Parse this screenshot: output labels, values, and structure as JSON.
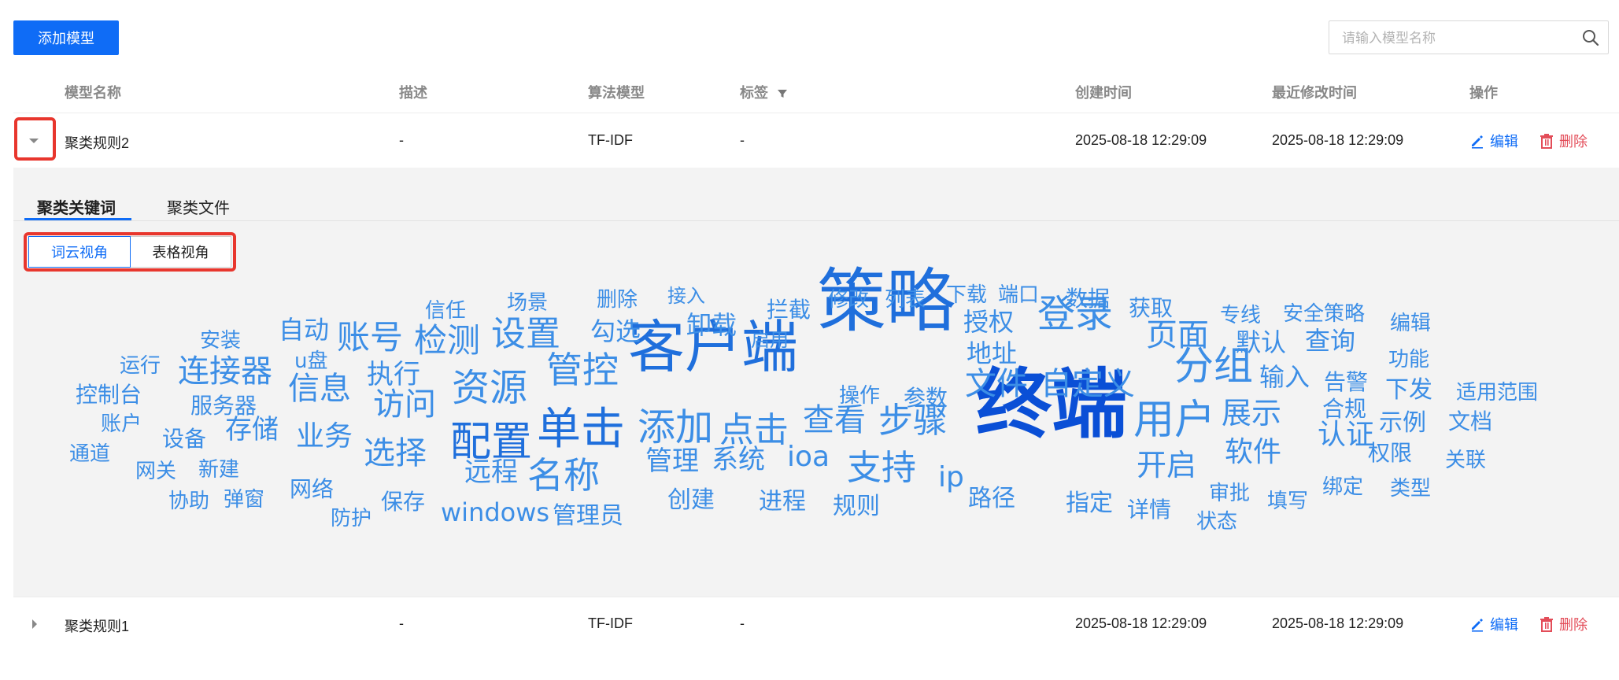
{
  "toolbar": {
    "add_label": "添加模型",
    "search_placeholder": "请输入模型名称"
  },
  "columns": {
    "name": "模型名称",
    "desc": "描述",
    "algo": "算法模型",
    "tags": "标签",
    "created": "创建时间",
    "modified": "最近修改时间",
    "actions": "操作"
  },
  "rows": [
    {
      "name": "聚类规则2",
      "desc": "-",
      "algo": "TF-IDF",
      "tags": "-",
      "created": "2025-08-18 12:29:09",
      "modified": "2025-08-18 12:29:09",
      "edit": "编辑",
      "delete": "删除",
      "expanded": true
    },
    {
      "name": "聚类规则1",
      "desc": "-",
      "algo": "TF-IDF",
      "tags": "-",
      "created": "2025-08-18 12:29:09",
      "modified": "2025-08-18 12:29:09",
      "edit": "编辑",
      "delete": "删除",
      "expanded": false
    }
  ],
  "detail": {
    "tabs": [
      {
        "label": "聚类关键词",
        "active": true
      },
      {
        "label": "聚类文件",
        "active": false
      }
    ],
    "views": [
      {
        "label": "词云视角",
        "active": true
      },
      {
        "label": "表格视角",
        "active": false
      }
    ]
  },
  "wordcloud": {
    "colors": {
      "dark": "#0a4fd6",
      "mid": "#1f6fdc",
      "light": "#3c8ee6"
    },
    "words": [
      {
        "text": "终端",
        "tier": "dark"
      },
      {
        "text": "策略",
        "tier": "mid"
      },
      {
        "text": "客户端",
        "tier": "mid"
      },
      {
        "text": "单击",
        "tier": "mid"
      },
      {
        "text": "配置",
        "tier": "mid"
      },
      {
        "text": "添加",
        "tier": "light"
      },
      {
        "text": "点击",
        "tier": "light"
      },
      {
        "text": "用户",
        "tier": "light"
      },
      {
        "text": "分组",
        "tier": "light"
      },
      {
        "text": "登录",
        "tier": "light"
      },
      {
        "text": "资源",
        "tier": "light"
      },
      {
        "text": "管控",
        "tier": "light"
      },
      {
        "text": "设置",
        "tier": "light"
      },
      {
        "text": "检测",
        "tier": "light"
      },
      {
        "text": "账号",
        "tier": "light"
      },
      {
        "text": "连接器",
        "tier": "light"
      },
      {
        "text": "名称",
        "tier": "light"
      },
      {
        "text": "支持",
        "tier": "light"
      },
      {
        "text": "步骤",
        "tier": "light"
      },
      {
        "text": "查看",
        "tier": "light"
      },
      {
        "text": "访问",
        "tier": "light"
      },
      {
        "text": "文件",
        "tier": "light"
      },
      {
        "text": "自定义",
        "tier": "light"
      },
      {
        "text": "页面",
        "tier": "light"
      },
      {
        "text": "选择",
        "tier": "light"
      },
      {
        "text": "信息",
        "tier": "light"
      },
      {
        "text": "展示",
        "tier": "light"
      },
      {
        "text": "开启",
        "tier": "light"
      },
      {
        "text": "软件",
        "tier": "light"
      },
      {
        "text": "业务",
        "tier": "light"
      },
      {
        "text": "ioa",
        "tier": "light"
      },
      {
        "text": "系统",
        "tier": "light"
      },
      {
        "text": "管理",
        "tier": "light"
      },
      {
        "text": "远程",
        "tier": "light"
      },
      {
        "text": "执行",
        "tier": "light"
      },
      {
        "text": "存储",
        "tier": "light"
      },
      {
        "text": "授权",
        "tier": "light"
      },
      {
        "text": "地址",
        "tier": "light"
      },
      {
        "text": "认证",
        "tier": "light"
      },
      {
        "text": "默认",
        "tier": "light"
      },
      {
        "text": "输入",
        "tier": "light"
      },
      {
        "text": "查询",
        "tier": "light"
      },
      {
        "text": "勾选",
        "tier": "light"
      },
      {
        "text": "卸载",
        "tier": "light"
      },
      {
        "text": "自动",
        "tier": "light"
      },
      {
        "text": "ip",
        "tier": "light"
      },
      {
        "text": "windows",
        "tier": "light"
      },
      {
        "text": "管理员",
        "tier": "light"
      },
      {
        "text": "创建",
        "tier": "light"
      },
      {
        "text": "进程",
        "tier": "light"
      },
      {
        "text": "规则",
        "tier": "light"
      },
      {
        "text": "路径",
        "tier": "light"
      },
      {
        "text": "指定",
        "tier": "light"
      },
      {
        "text": "详情",
        "tier": "light"
      },
      {
        "text": "状态",
        "tier": "light"
      },
      {
        "text": "审批",
        "tier": "light"
      },
      {
        "text": "填写",
        "tier": "light"
      },
      {
        "text": "绑定",
        "tier": "light"
      },
      {
        "text": "类型",
        "tier": "light"
      },
      {
        "text": "权限",
        "tier": "light"
      },
      {
        "text": "关联",
        "tier": "light"
      },
      {
        "text": "示例",
        "tier": "light"
      },
      {
        "text": "文档",
        "tier": "light"
      },
      {
        "text": "合规",
        "tier": "light"
      },
      {
        "text": "告警",
        "tier": "light"
      },
      {
        "text": "下发",
        "tier": "light"
      },
      {
        "text": "适用范围",
        "tier": "light"
      },
      {
        "text": "功能",
        "tier": "light"
      },
      {
        "text": "编辑",
        "tier": "light"
      },
      {
        "text": "安全策略",
        "tier": "light"
      },
      {
        "text": "专线",
        "tier": "light"
      },
      {
        "text": "获取",
        "tier": "light"
      },
      {
        "text": "数据",
        "tier": "light"
      },
      {
        "text": "端口",
        "tier": "light"
      },
      {
        "text": "下载",
        "tier": "light"
      },
      {
        "text": "列表",
        "tier": "light"
      },
      {
        "text": "修改",
        "tier": "light"
      },
      {
        "text": "拦截",
        "tier": "light"
      },
      {
        "text": "启用",
        "tier": "light"
      },
      {
        "text": "接入",
        "tier": "light"
      },
      {
        "text": "删除",
        "tier": "light"
      },
      {
        "text": "场景",
        "tier": "light"
      },
      {
        "text": "信任",
        "tier": "light"
      },
      {
        "text": "安装",
        "tier": "light"
      },
      {
        "text": "运行",
        "tier": "light"
      },
      {
        "text": "u盘",
        "tier": "light"
      },
      {
        "text": "控制台",
        "tier": "light"
      },
      {
        "text": "账户",
        "tier": "light"
      },
      {
        "text": "服务器",
        "tier": "light"
      },
      {
        "text": "通道",
        "tier": "light"
      },
      {
        "text": "设备",
        "tier": "light"
      },
      {
        "text": "网关",
        "tier": "light"
      },
      {
        "text": "新建",
        "tier": "light"
      },
      {
        "text": "协助",
        "tier": "light"
      },
      {
        "text": "弹窗",
        "tier": "light"
      },
      {
        "text": "网络",
        "tier": "light"
      },
      {
        "text": "防护",
        "tier": "light"
      },
      {
        "text": "保存",
        "tier": "light"
      },
      {
        "text": "操作",
        "tier": "light"
      },
      {
        "text": "参数",
        "tier": "light"
      }
    ]
  }
}
